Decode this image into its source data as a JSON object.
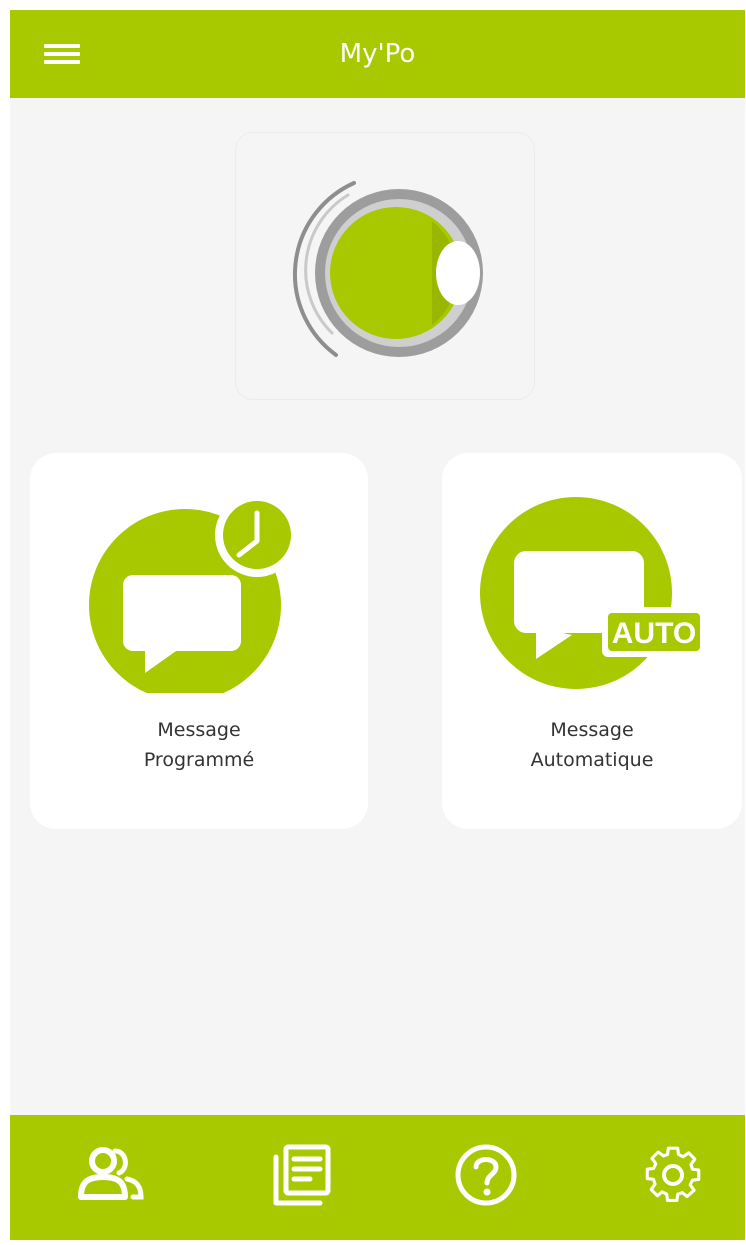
{
  "app_bar": {
    "title": "My'Po",
    "menu_icon": "hamburger-menu-icon"
  },
  "logo": {
    "icon": "mypo-eye-logo"
  },
  "tiles": [
    {
      "line1": "Message",
      "line2": "Programmé",
      "icon": "scheduled-message-icon"
    },
    {
      "line1": "Message",
      "line2": "Automatique",
      "icon": "automatic-message-icon",
      "badge": "AUTO"
    }
  ],
  "bottom_nav": [
    {
      "icon": "contacts-icon"
    },
    {
      "icon": "document-list-icon"
    },
    {
      "icon": "help-icon"
    },
    {
      "icon": "settings-icon"
    }
  ],
  "colors": {
    "accent": "#a8c800",
    "background": "#f5f5f5",
    "card": "#ffffff",
    "logo_gray": "#9a9a9a"
  }
}
